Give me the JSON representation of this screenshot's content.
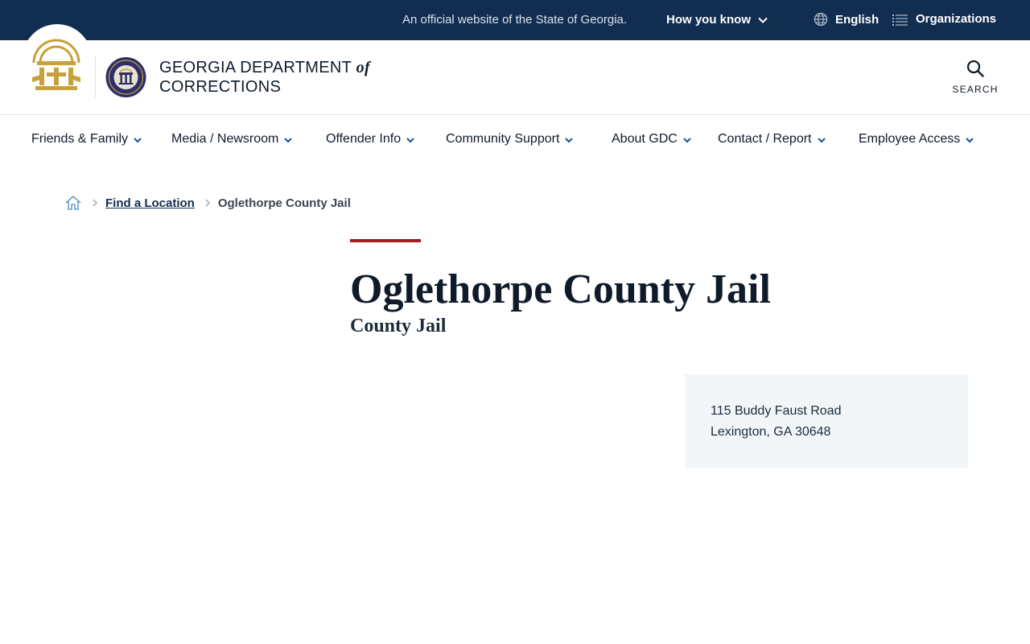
{
  "topbar": {
    "official_text": "An official website of the State of Georgia.",
    "how_you_know": "How you know",
    "language": "English",
    "organizations": "Organizations"
  },
  "header": {
    "title_line1": "GEORGIA DEPARTMENT",
    "title_of": "of",
    "title_line2": "CORRECTIONS",
    "search_label": "SEARCH"
  },
  "nav": {
    "items": [
      {
        "label": "Friends & Family"
      },
      {
        "label": "Media / Newsroom"
      },
      {
        "label": "Offender Info"
      },
      {
        "label": "Community Support"
      },
      {
        "label": "About GDC"
      },
      {
        "label": "Contact / Report"
      },
      {
        "label": "Employee Access"
      }
    ]
  },
  "breadcrumb": {
    "link": "Find a Location",
    "current": "Oglethorpe County Jail"
  },
  "page": {
    "title": "Oglethorpe County Jail",
    "subtitle": "County Jail"
  },
  "address": {
    "street": "115 Buddy Faust Road",
    "city_state_zip": "Lexington, GA 30648"
  },
  "colors": {
    "topbar_bg": "#112e51",
    "accent_rule": "#a31b1b",
    "seal_gold": "#c9a13b",
    "card_bg": "#f2f6f9"
  },
  "icons": [
    "chevron-down-icon",
    "globe-icon",
    "list-icon",
    "search-icon",
    "home-icon",
    "chevron-right-icon",
    "georgia-seal-icon",
    "gdc-seal-icon"
  ]
}
